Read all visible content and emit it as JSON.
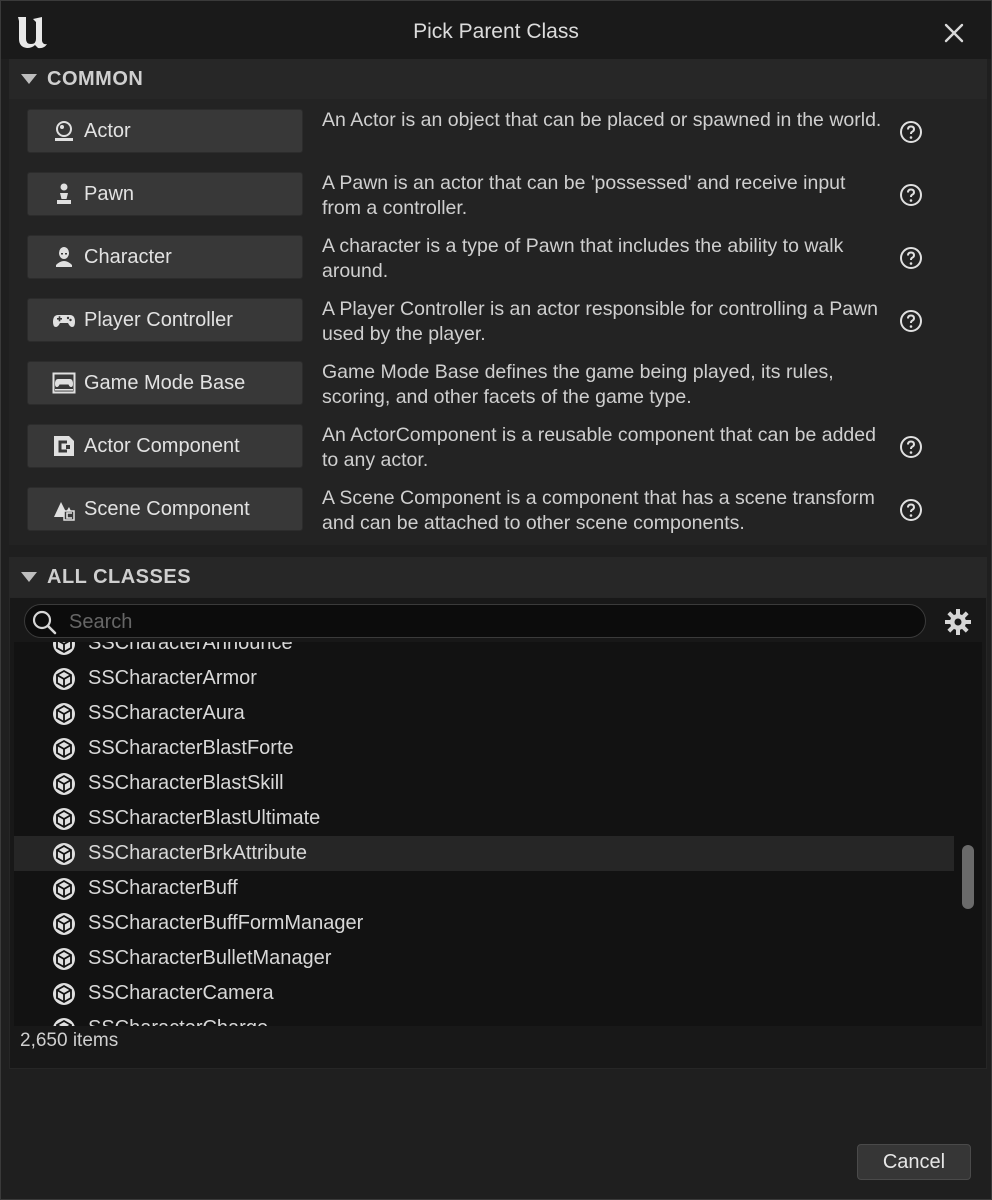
{
  "window": {
    "title": "Pick Parent Class"
  },
  "common": {
    "header": "COMMON",
    "items": [
      {
        "label": "Actor",
        "icon": "actor-icon",
        "description": "An Actor is an object that can be placed or spawned in the world.",
        "help": true
      },
      {
        "label": "Pawn",
        "icon": "pawn-icon",
        "description": "A Pawn is an actor that can be 'possessed' and receive input from a controller.",
        "help": true
      },
      {
        "label": "Character",
        "icon": "character-icon",
        "description": "A character is a type of Pawn that includes the ability to walk around.",
        "help": true
      },
      {
        "label": "Player Controller",
        "icon": "gamepad-icon",
        "description": "A Player Controller is an actor responsible for controlling a Pawn used by the player.",
        "help": true
      },
      {
        "label": "Game Mode Base",
        "icon": "game-mode-icon",
        "description": "Game Mode Base defines the game being played, its rules, scoring, and other facets of the game type.",
        "help": false
      },
      {
        "label": "Actor Component",
        "icon": "actor-component-icon",
        "description": "An ActorComponent is a reusable component that can be added to any actor.",
        "help": true
      },
      {
        "label": "Scene Component",
        "icon": "scene-component-icon",
        "description": "A Scene Component is a component that has a scene transform and can be attached to other scene components.",
        "help": true
      }
    ]
  },
  "all_classes": {
    "header": "ALL CLASSES",
    "search_placeholder": "Search",
    "items": [
      "SSCharacterAnnounce",
      "SSCharacterArmor",
      "SSCharacterAura",
      "SSCharacterBlastForte",
      "SSCharacterBlastSkill",
      "SSCharacterBlastUltimate",
      "SSCharacterBrkAttribute",
      "SSCharacterBuff",
      "SSCharacterBuffFormManager",
      "SSCharacterBulletManager",
      "SSCharacterCamera",
      "SSCharacterCharge"
    ],
    "selected_index": 6,
    "status": "2,650 items"
  },
  "footer": {
    "cancel_label": "Cancel"
  }
}
